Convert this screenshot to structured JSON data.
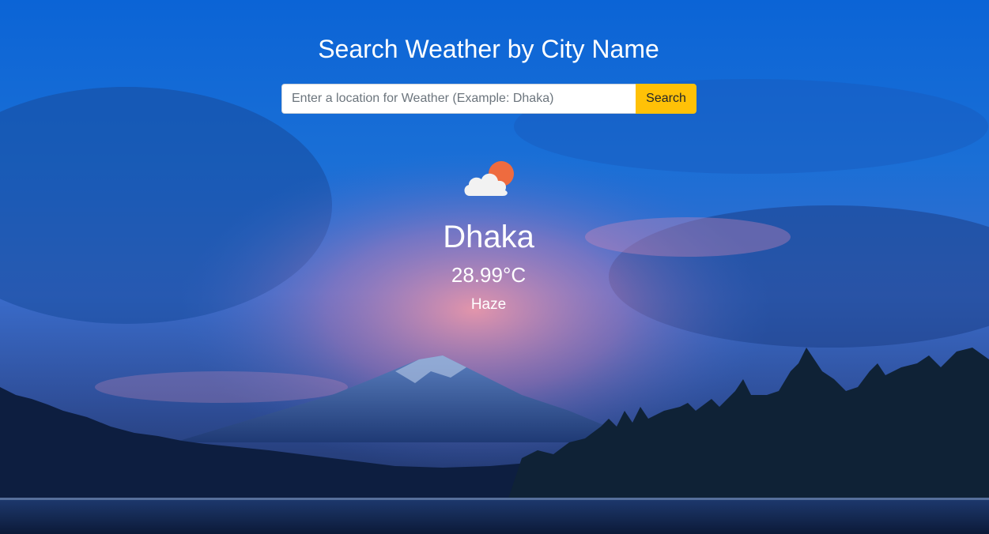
{
  "header": {
    "title": "Search Weather by City Name"
  },
  "search": {
    "placeholder": "Enter a location for Weather (Example: Dhaka)",
    "value": "",
    "button_label": "Search"
  },
  "weather": {
    "icon": "partly-cloudy-icon",
    "city": "Dhaka",
    "temperature": "28.99°C",
    "description": "Haze"
  },
  "colors": {
    "search_button": "#ffc107",
    "sun": "#ee6b3f",
    "cloud": "#f2f2f2"
  }
}
